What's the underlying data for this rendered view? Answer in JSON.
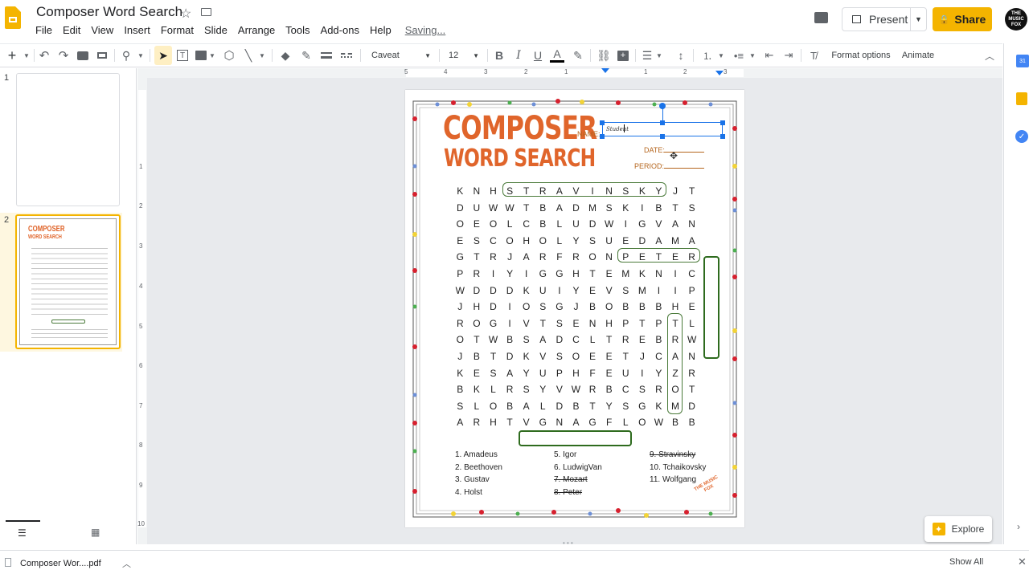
{
  "doc_title": "Composer Word Search",
  "menu": [
    "File",
    "Edit",
    "View",
    "Insert",
    "Format",
    "Slide",
    "Arrange",
    "Tools",
    "Add-ons",
    "Help"
  ],
  "saving": "Saving...",
  "present_label": "Present",
  "share_label": "Share",
  "avatar_text": "THE MUSIC FOX",
  "toolbar": {
    "font": "Caveat",
    "font_size": "12",
    "format_options": "Format options",
    "animate": "Animate"
  },
  "slides": [
    {
      "num": "1"
    },
    {
      "num": "2"
    }
  ],
  "ruler_top": [
    "5",
    "4",
    "3",
    "2",
    "1",
    "1",
    "2",
    "3"
  ],
  "ruler_left": [
    "1",
    "2",
    "3",
    "4",
    "5",
    "6",
    "7",
    "8",
    "9",
    "10"
  ],
  "worksheet": {
    "title_line1": "COMPOSER",
    "title_line2": "WORD SEARCH",
    "name_label": "NAME:",
    "name_value": "Student",
    "date_label": "DATE:",
    "period_label": "PERIOD:",
    "grid": [
      "KNHSTRAVINSKYJT",
      "DUWWTBADMSKIBTS",
      "OEOLCBLUDWIGVAN",
      "ESCOHOLYSUEDAMA",
      "GTRJARFRONPETER",
      "PRIYIGGHTEMKNIC",
      "WDDDKUIYEVSMIIP",
      "JHDIOSGJBOBBBHE",
      "ROGIVTSENHPTPTL",
      "OTWBSADCLTREBRW",
      "JBTDKVSOEETJCAN",
      "KESAYUPHFEUIYZR",
      "BKLRSYVWRBCSROT",
      "SLOBALDBTYSGKMD",
      "ARHTVGNAGFLOWBB"
    ],
    "words": [
      {
        "text": "1. Amadeus",
        "found": false
      },
      {
        "text": "2. Beethoven",
        "found": false
      },
      {
        "text": "3. Gustav",
        "found": false
      },
      {
        "text": "4. Holst",
        "found": false
      },
      {
        "text": "5. Igor",
        "found": false
      },
      {
        "text": "6. LudwigVan",
        "found": false
      },
      {
        "text": "7. Mozart",
        "found": true
      },
      {
        "text": "8. Peter",
        "found": true
      },
      {
        "text": "9. Stravinsky",
        "found": true
      },
      {
        "text": "10. Tchaikovsky",
        "found": false
      },
      {
        "text": "11. Wolfgang",
        "found": false
      }
    ],
    "logo_text": "THE MUSIC FOX"
  },
  "explore_label": "Explore",
  "download": {
    "file": "Composer Wor....pdf",
    "show_all": "Show All"
  },
  "colors": {
    "accent": "#f4b400",
    "title": "#e0652b",
    "found_box": "#4a7a3a",
    "selection": "#1a73e8"
  }
}
